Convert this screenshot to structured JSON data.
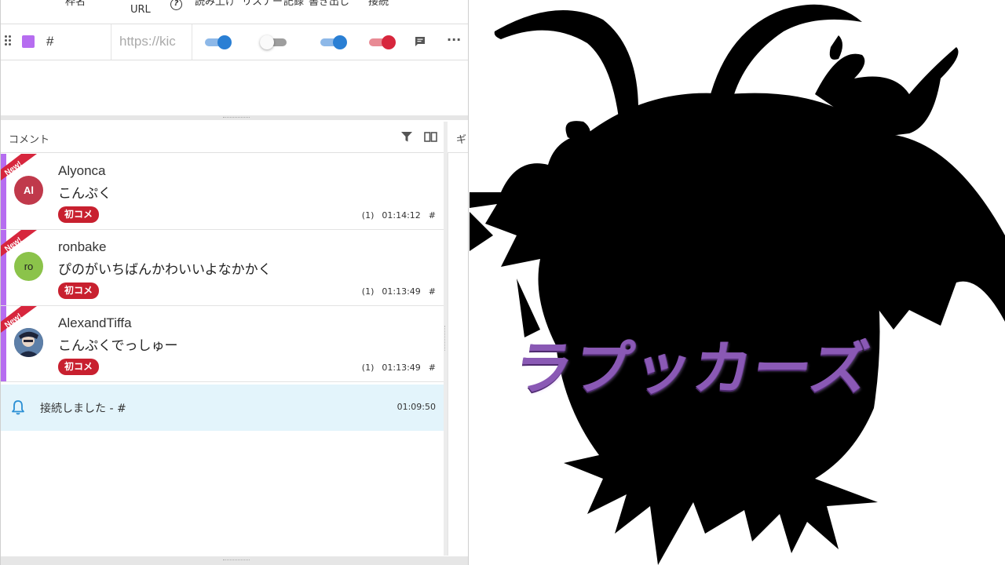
{
  "header": {
    "col_name": "枠名",
    "col_url": "URL",
    "col_read": "読み上げ",
    "col_listener": "リスナー",
    "col_record": "記録",
    "col_export": "書き出し",
    "col_connect": "接続"
  },
  "connection": {
    "name": "#",
    "url_placeholder": "https://kick.com/...",
    "url_value": "https://kic",
    "swatch_color": "#b66df0",
    "toggles": {
      "read": true,
      "listener": false,
      "record": true,
      "connect": true
    }
  },
  "comments_panel": {
    "title": "コメント",
    "gift_panel_title": "ギ"
  },
  "comments": [
    {
      "new_label": "New!",
      "name": "Alyonca",
      "avatar_text": "Al",
      "avatar_color": "#c0394b",
      "text": "こんぷく",
      "badge": "初コメ",
      "count": "(1)",
      "time": "01:14:12",
      "frame": "#"
    },
    {
      "new_label": "New!",
      "name": "ronbake",
      "avatar_text": "ro",
      "avatar_color": "#8bc34a",
      "text": "ぴのがいちばんかわいいよなかかく",
      "badge": "初コメ",
      "count": "(1)",
      "time": "01:13:49",
      "frame": "#"
    },
    {
      "new_label": "New!",
      "name": "AlexandTiffa",
      "avatar_text": "",
      "avatar_color": "#2b3a55",
      "text": "こんぷくでっしゅー",
      "badge": "初コメ",
      "count": "(1)",
      "time": "01:13:49",
      "frame": "#"
    }
  ],
  "system_message": {
    "text": "接続しました - #",
    "time": "01:09:50"
  },
  "artwork": {
    "title": "ラプッカーズ",
    "title_color": "#8a59b5"
  }
}
